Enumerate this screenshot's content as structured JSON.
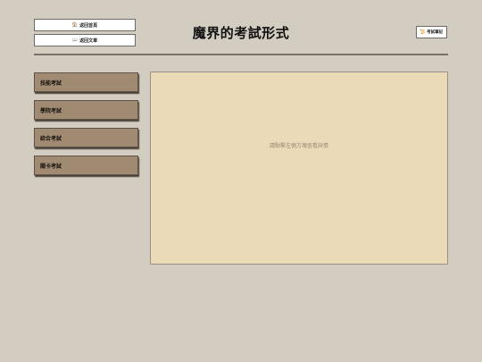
{
  "header": {
    "home_button": {
      "icon": "house-icon",
      "label": "返回首頁"
    },
    "article_button": {
      "icon": "book-icon",
      "label": "返回文章"
    },
    "title": "魔界的考試形式",
    "notes_button": {
      "icon": "scroll-icon",
      "label": "考試筆記"
    }
  },
  "menu": {
    "items": [
      {
        "label": "技能考試"
      },
      {
        "label": "學院考試"
      },
      {
        "label": "綜合考試"
      },
      {
        "label": "關卡考試"
      }
    ]
  },
  "detail": {
    "hint": "請點擊左側方塊查看詳情"
  },
  "colors": {
    "background": "#d3cdc1",
    "menu_item": "#a08a72",
    "panel": "#eadab8",
    "divider": "#7b736a"
  }
}
